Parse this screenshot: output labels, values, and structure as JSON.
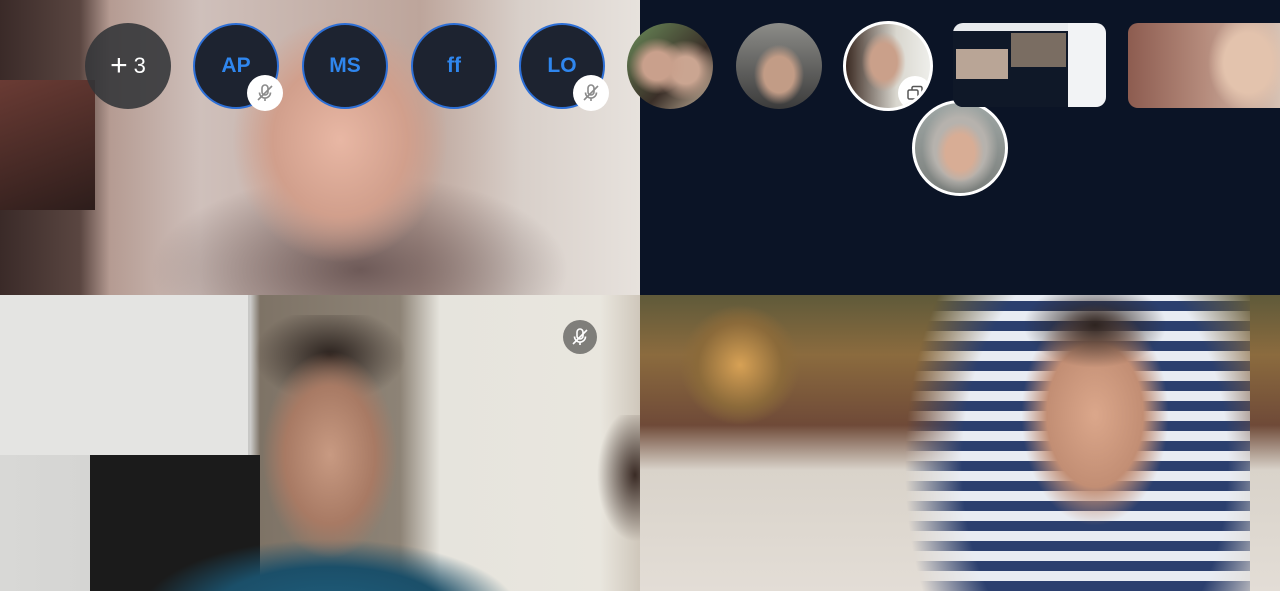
{
  "participants_strip": {
    "more": {
      "plus": "+",
      "count": "3"
    },
    "initials": [
      {
        "label": "AP",
        "muted": true
      },
      {
        "label": "MS",
        "muted": false
      },
      {
        "label": "ff",
        "muted": false
      },
      {
        "label": "LO",
        "muted": true
      }
    ],
    "icons": {
      "mute": "microphone-muted-icon",
      "share": "screen-share-icon"
    }
  },
  "colors": {
    "background": "#0b1426",
    "initials_text": "#2f86ee",
    "initials_border": "#2d6fd6",
    "badge_bg": "#ffffff"
  }
}
